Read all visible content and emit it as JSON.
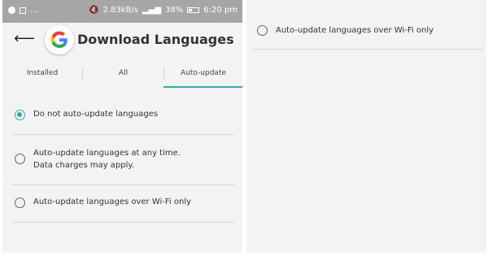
{
  "status_bar": {
    "speed": "2.83kB/s",
    "battery": "38%",
    "time": "6:20 pm"
  },
  "app_bar": {
    "title": "Download Languages",
    "logo_letter": "G"
  },
  "tabs": [
    {
      "label": "Installed",
      "selected": false
    },
    {
      "label": "All",
      "selected": false
    },
    {
      "label": "Auto-update",
      "selected": true
    }
  ],
  "options": [
    {
      "label": "Do not auto-update languages",
      "selected": true
    },
    {
      "line1": "Auto-update languages at any time.",
      "line2": "Data charges may apply.",
      "selected": false
    },
    {
      "label": "Auto-update languages over Wi-Fi only",
      "selected": false
    }
  ],
  "right_panel_option": {
    "label": "Auto-update languages over Wi-Fi only",
    "selected": false
  },
  "colors": {
    "accent": "#3aa8a3",
    "status_bar": "#a6a6a6",
    "background": "#f3f3f3"
  },
  "icons": [
    "back-arrow-icon",
    "google-g-logo-icon",
    "mute-icon",
    "battery-icon",
    "radio-button-icon"
  ]
}
